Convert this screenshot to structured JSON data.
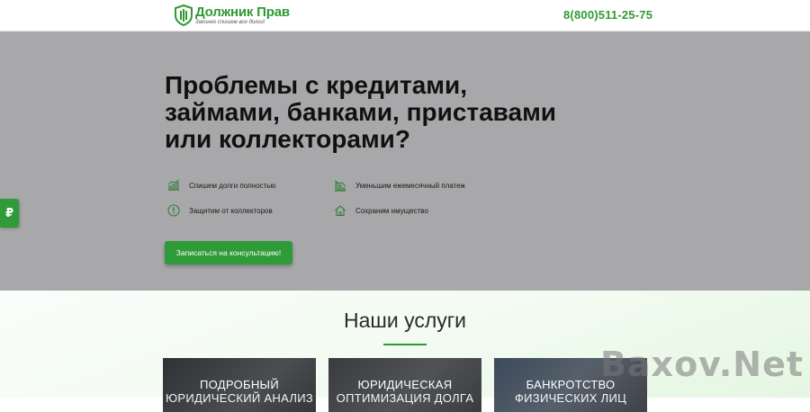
{
  "header": {
    "logo_name": "Должник Прав",
    "logo_tagline": "Законно спишем все долги!",
    "phone": "8(800)511-25-75"
  },
  "hero": {
    "title": "Проблемы с кредитами, займами, банками, приставами или коллекторами?",
    "features": [
      {
        "icon": "chart-up-icon",
        "label": "Спишем долги полностью"
      },
      {
        "icon": "chart-down-icon",
        "label": "Уменьшим ежемесячный платеж"
      },
      {
        "icon": "shield-exclamation-icon",
        "label": "Защитим от коллекторов"
      },
      {
        "icon": "house-icon",
        "label": "Сохраним имущество"
      }
    ],
    "cta_label": "Записаться на консультацию!"
  },
  "side_tab": {
    "symbol": "₽"
  },
  "services": {
    "title": "Наши услуги",
    "cards": [
      {
        "title": "ПОДРОБНЫЙ",
        "subtitle": "ЮРИДИЧЕСКИЙ АНАЛИЗ"
      },
      {
        "title": "ЮРИДИЧЕСКАЯ",
        "subtitle": "ОПТИМИЗАЦИЯ ДОЛГА"
      },
      {
        "title": "БАНКРОТСТВО",
        "subtitle": "ФИЗИЧЕСКИХ ЛИЦ"
      }
    ]
  },
  "watermark": "Baxov.Net",
  "colors": {
    "accent": "#2e9a38",
    "hero_bg": "#a8a8aa",
    "card_bg": "#3d3f43"
  }
}
